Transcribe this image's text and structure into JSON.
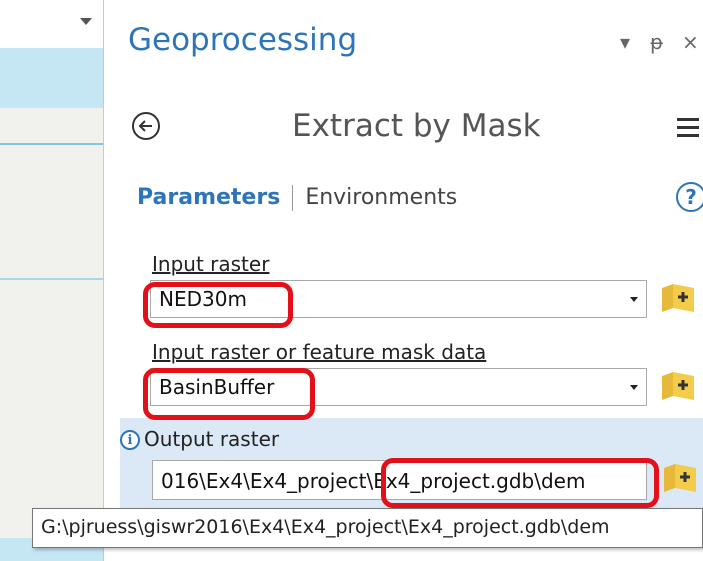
{
  "geoprocessing": {
    "title": "Geoprocessing",
    "ctrl_dropdown": "▾",
    "ctrl_pin": "ᵽ",
    "ctrl_close": "×"
  },
  "tool": {
    "title": "Extract by Mask"
  },
  "tabs": {
    "parameters": "Parameters",
    "environments": "Environments"
  },
  "help_glyph": "?",
  "params": {
    "input_raster_label": "Input raster",
    "input_raster_value": "NED30m",
    "mask_label": "Input raster or feature mask data",
    "mask_value": "BasinBuffer",
    "output_label": "Output raster",
    "output_value": "016\\Ex4\\Ex4_project\\Ex4_project.gdb\\dem"
  },
  "tooltip": {
    "text": "G:\\pjruess\\giswr2016\\Ex4\\Ex4_project\\Ex4_project.gdb\\dem"
  },
  "colors": {
    "accent": "#2d75b8",
    "highlight": "#e3101a",
    "folder": "#f2cc4a"
  }
}
